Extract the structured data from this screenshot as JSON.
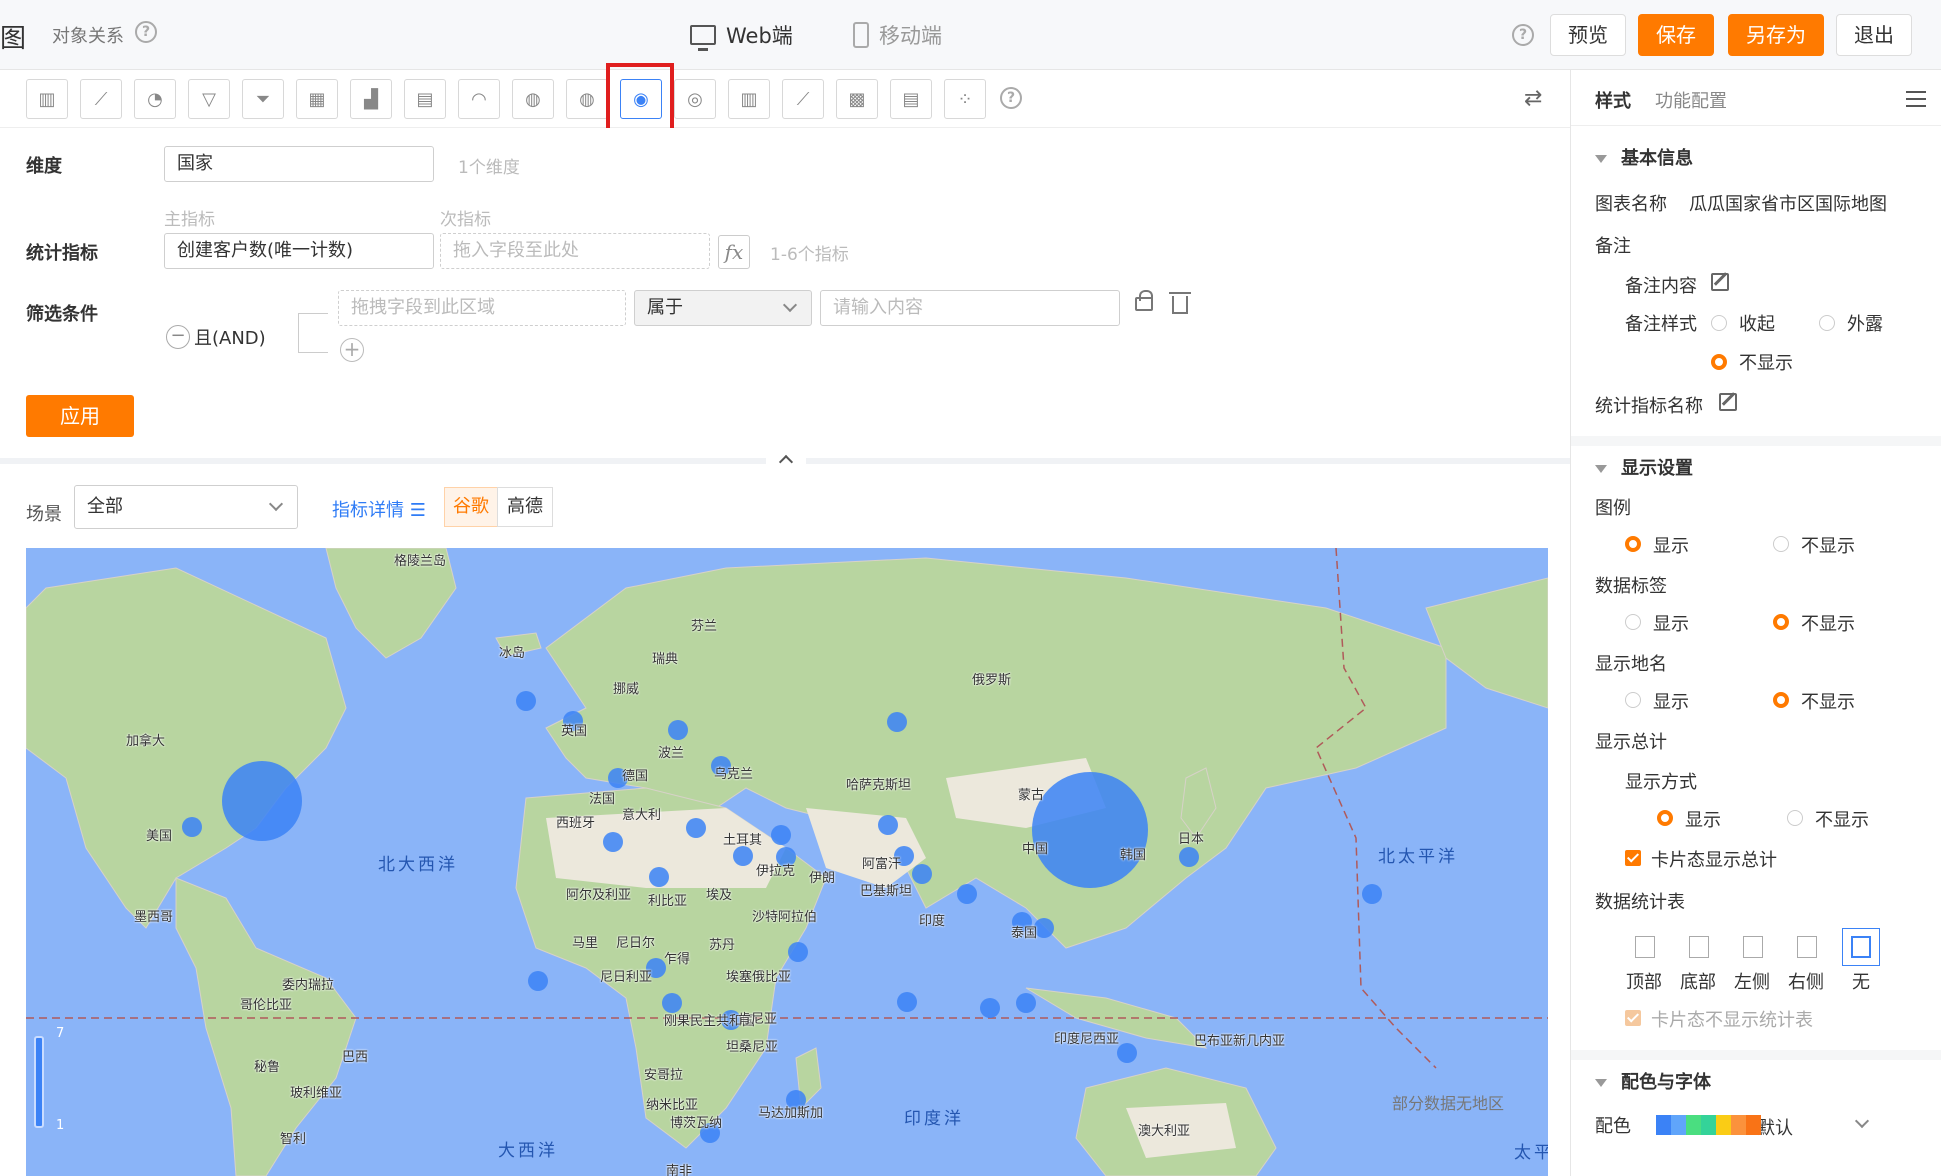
{
  "header": {
    "title_fragment": "图",
    "relation": "对象关系",
    "tabs": [
      {
        "label": "Web端"
      },
      {
        "label": "移动端"
      }
    ],
    "buttons": {
      "preview": "预览",
      "save": "保存",
      "save_as": "另存为",
      "exit": "退出"
    }
  },
  "chart_types": [
    "bar",
    "line",
    "pie",
    "funnel",
    "funnel-alt",
    "table",
    "combo",
    "text",
    "gauge",
    "china-map",
    "china-map-alt",
    "world-map",
    "map-bubble",
    "column",
    "scatter-line",
    "heat-table",
    "pivot-table",
    "scatter"
  ],
  "config": {
    "dimension": {
      "label": "维度",
      "value": "国家",
      "hint": "1个维度"
    },
    "metric": {
      "label": "统计指标",
      "primary_label": "主指标",
      "secondary_label": "次指标",
      "primary_value": "创建客户数(唯一计数)",
      "secondary_placeholder": "拖入字段至此处",
      "fx": "fx",
      "hint": "1-6个指标"
    },
    "filter": {
      "label": "筛选条件",
      "logic": "且(AND)",
      "field_placeholder": "拖拽字段到此区域",
      "operator": "属于",
      "value_placeholder": "请输入内容"
    },
    "apply": "应用"
  },
  "chart_controls": {
    "scene_label": "场景",
    "scene_value": "全部",
    "metric_detail": "指标详情",
    "map_sources": [
      "谷歌",
      "高德"
    ]
  },
  "map": {
    "countries": [
      "格陵兰岛",
      "冰岛",
      "芬兰",
      "瑞典",
      "挪威",
      "俄罗斯",
      "加拿大",
      "英国",
      "波兰",
      "德国",
      "乌克兰",
      "哈萨克斯坦",
      "法国",
      "意大利",
      "西班牙",
      "蒙古",
      "美国",
      "土耳其",
      "伊拉克",
      "伊朗",
      "阿富汗",
      "中国",
      "韩国",
      "日本",
      "阿尔及利亚",
      "利比亚",
      "埃及",
      "巴基斯坦",
      "沙特阿拉伯",
      "印度",
      "墨西哥",
      "马里",
      "尼日尔",
      "苏丹",
      "乍得",
      "泰国",
      "委内瑞拉",
      "尼日利亚",
      "埃塞俄比亚",
      "哥伦比亚",
      "刚果民主共和国",
      "肯尼亚",
      "印度尼西亚",
      "巴布亚新几内亚",
      "秘鲁",
      "巴西",
      "坦桑尼亚",
      "安哥拉",
      "玻利维亚",
      "纳米比亚",
      "马达加斯加",
      "博茨瓦纳",
      "澳大利亚",
      "智利",
      "南非"
    ],
    "oceans": [
      "北大西洋",
      "北太平洋",
      "印度洋",
      "大西洋",
      "太平"
    ],
    "legend_max": "7",
    "legend_min": "1",
    "note": "部分数据无地区",
    "bubble_color": "#3b82f6"
  },
  "right_panel": {
    "tabs": [
      "样式",
      "功能配置"
    ],
    "basic": {
      "title": "基本信息",
      "chart_name_label": "图表名称",
      "chart_name": "瓜瓜国家省市区国际地图",
      "remark": "备注",
      "remark_content": "备注内容",
      "remark_style": "备注样式",
      "remark_options": [
        "收起",
        "外露",
        "不显示"
      ],
      "metric_name": "统计指标名称"
    },
    "display": {
      "title": "显示设置",
      "legend": "图例",
      "data_label": "数据标签",
      "place_name": "显示地名",
      "total": "显示总计",
      "total_mode": "显示方式",
      "show": "显示",
      "hide": "不显示",
      "card_total": "卡片态显示总计",
      "stat_table": "数据统计表",
      "positions": [
        "顶部",
        "底部",
        "左侧",
        "右侧",
        "无"
      ],
      "card_no_table": "卡片态不显示统计表"
    },
    "color_font": {
      "title": "配色与字体",
      "palette_label": "配色",
      "palette_value": "默认",
      "palette": [
        "#3b82f6",
        "#60a5fa",
        "#4ade80",
        "#34d399",
        "#facc15",
        "#fb923c",
        "#f97316"
      ]
    }
  }
}
